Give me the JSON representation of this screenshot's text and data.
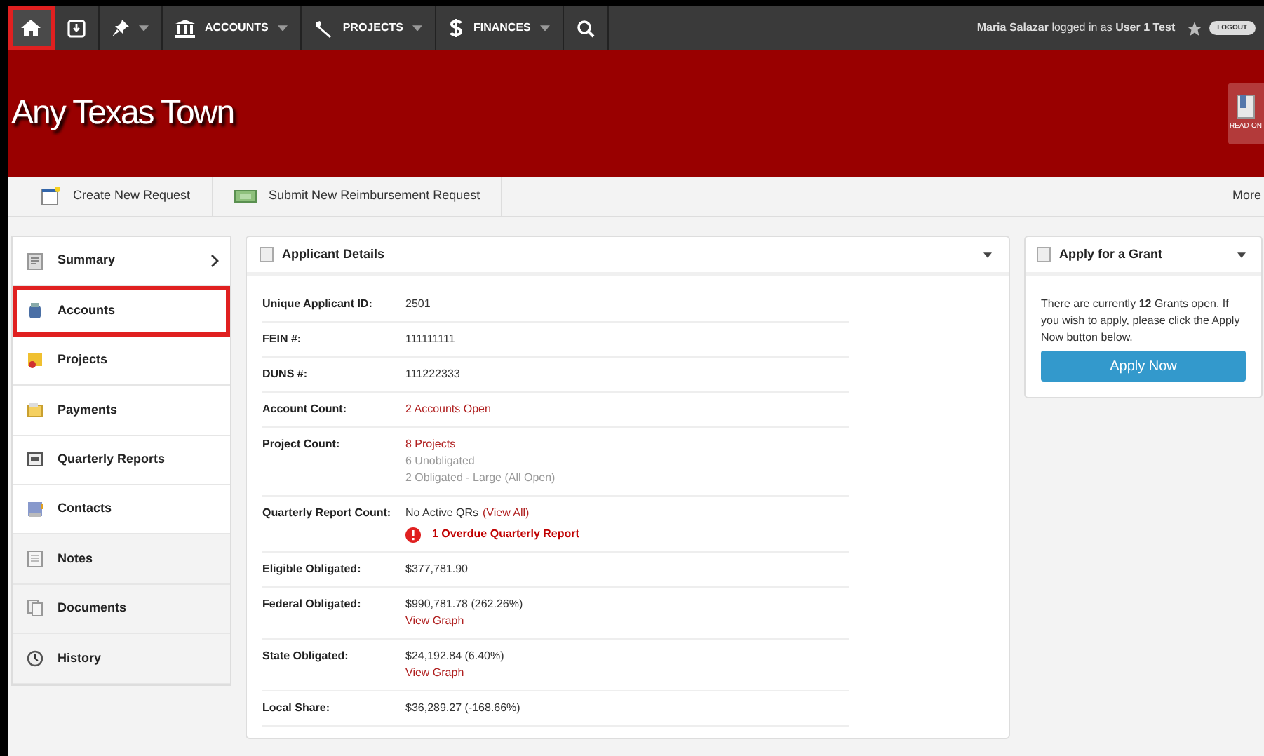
{
  "top_nav": {
    "items": [
      {
        "dropdown": false,
        "highlighted": true
      },
      {
        "dropdown": false,
        "highlighted": false
      },
      {
        "dropdown": true,
        "highlighted": false
      },
      {
        "label": "ACCOUNTS",
        "dropdown": true,
        "highlighted": false
      },
      {
        "label": "PROJECTS",
        "dropdown": true,
        "highlighted": false
      },
      {
        "label": "FINANCES",
        "dropdown": true,
        "highlighted": false
      },
      {
        "dropdown": false,
        "highlighted": false
      }
    ],
    "user_text": "**Maria Salazar** logged in as **User 1 Test**",
    "logout": "LOGOUT"
  },
  "banner": {
    "title": "Any Texas Town",
    "badge": "READ-ON"
  },
  "toolbar": {
    "actions": [
      "Create New Request",
      "Submit New Reimbursement Request"
    ],
    "more": "More"
  },
  "sidebar": {
    "items": [
      {
        "label": "Summary",
        "kind": "main",
        "arrow": true,
        "highlighted": false
      },
      {
        "label": "Accounts",
        "kind": "main",
        "arrow": false,
        "highlighted": true
      },
      {
        "label": "Projects",
        "kind": "main",
        "arrow": false,
        "highlighted": false
      },
      {
        "label": "Payments",
        "kind": "main",
        "arrow": false,
        "highlighted": false
      },
      {
        "label": "Quarterly Reports",
        "kind": "main",
        "arrow": false,
        "highlighted": false
      },
      {
        "label": "Contacts",
        "kind": "main",
        "arrow": false,
        "highlighted": false
      },
      {
        "label": "Notes",
        "kind": "other",
        "arrow": false,
        "highlighted": false
      },
      {
        "label": "Documents",
        "kind": "other",
        "arrow": false,
        "highlighted": false
      },
      {
        "label": "History",
        "kind": "other",
        "arrow": false,
        "highlighted": false
      }
    ]
  },
  "applicant_details": {
    "title": "Applicant Details",
    "rows": [
      {
        "label": "Unique Applicant ID:",
        "lines": [
          [
            {
              "text": "2501",
              "kind": "text"
            }
          ]
        ]
      },
      {
        "label": "FEIN #:",
        "lines": [
          [
            {
              "text": "111111111",
              "kind": "text"
            }
          ]
        ]
      },
      {
        "label": "DUNS #:",
        "lines": [
          [
            {
              "text": "111222333",
              "kind": "text"
            }
          ]
        ]
      },
      {
        "label": "Account Count:",
        "lines": [
          [
            {
              "text": "2 Accounts Open",
              "kind": "link"
            }
          ]
        ]
      },
      {
        "label": "Project Count:",
        "lines": [
          [
            {
              "text": "8 Projects",
              "kind": "link"
            }
          ],
          [
            {
              "text": "6 Unobligated",
              "kind": "muted"
            }
          ],
          [
            {
              "text": "2 Obligated - Large (All Open)",
              "kind": "muted"
            }
          ]
        ]
      },
      {
        "label": "Quarterly Report Count:",
        "lines": [
          [
            {
              "text": "No Active QRs",
              "kind": "text"
            },
            {
              "text": "(View All)",
              "kind": "link"
            }
          ],
          [
            {
              "text": "1 Overdue Quarterly Report",
              "kind": "alert"
            }
          ]
        ]
      },
      {
        "label": "Eligible Obligated:",
        "lines": [
          [
            {
              "text": "$377,781.90",
              "kind": "text"
            }
          ]
        ]
      },
      {
        "label": "Federal Obligated:",
        "lines": [
          [
            {
              "text": "$990,781.78 (262.26%)",
              "kind": "text"
            }
          ],
          [
            {
              "text": "View Graph",
              "kind": "link"
            }
          ]
        ]
      },
      {
        "label": "State Obligated:",
        "lines": [
          [
            {
              "text": "$24,192.84 (6.40%)",
              "kind": "text"
            }
          ],
          [
            {
              "text": "View Graph",
              "kind": "link"
            }
          ]
        ]
      },
      {
        "label": "Local Share:",
        "lines": [
          [
            {
              "text": "$36,289.27 (-168.66%)",
              "kind": "text"
            }
          ]
        ]
      }
    ]
  },
  "grant": {
    "title": "Apply for a Grant",
    "text": "There are currently **12** Grants open. If you wish to apply, please click the Apply Now button below.",
    "button": "Apply Now"
  }
}
